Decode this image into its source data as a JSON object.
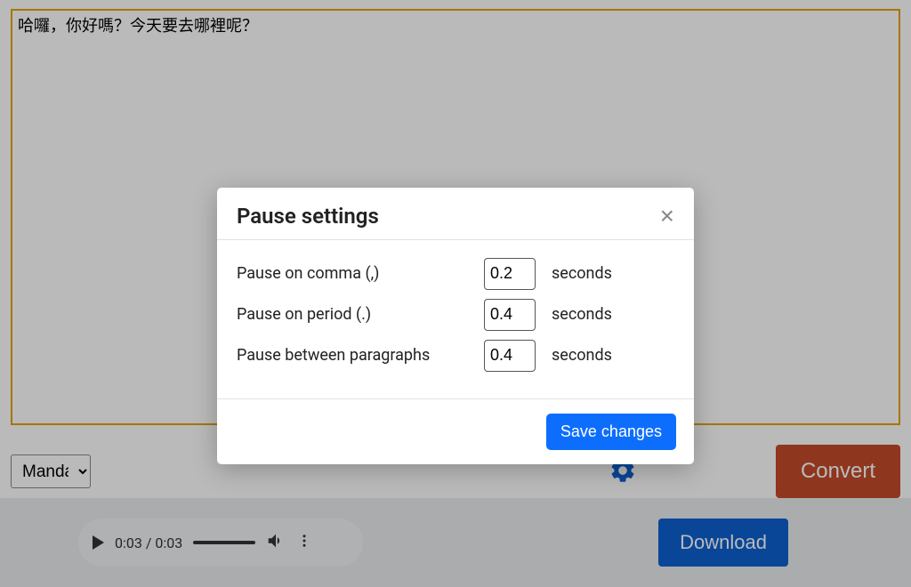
{
  "textarea": {
    "value": "哈囉，你好嗎？今天要去哪裡呢？"
  },
  "controls": {
    "language": "Mandarin",
    "convert_label": "Convert"
  },
  "audio": {
    "current_time": "0:03",
    "total_time": "0:03",
    "download_label": "Download"
  },
  "modal": {
    "title": "Pause settings",
    "rows": [
      {
        "label": "Pause on comma (,)",
        "value": "0.2",
        "unit": "seconds"
      },
      {
        "label": "Pause on period (.)",
        "value": "0.4",
        "unit": "seconds"
      },
      {
        "label": "Pause between paragraphs",
        "value": "0.4",
        "unit": "seconds"
      }
    ],
    "save_label": "Save changes"
  }
}
